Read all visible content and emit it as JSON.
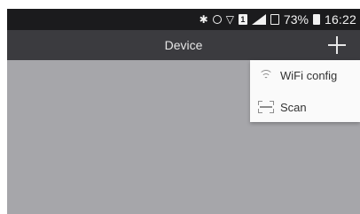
{
  "status_bar": {
    "battery_percent": "73%",
    "time": "16:22",
    "sim_label": "1",
    "icons": [
      "bluetooth-icon",
      "alarm-icon",
      "wifi-icon",
      "sim-icon",
      "signal-icon",
      "download-icon",
      "battery-icon"
    ]
  },
  "app_bar": {
    "title": "Device",
    "add_icon": "plus-icon"
  },
  "menu": {
    "items": [
      {
        "label": "WiFi config",
        "icon": "wifi-icon"
      },
      {
        "label": "Scan",
        "icon": "scan-icon"
      }
    ]
  },
  "colors": {
    "status_bar_bg": "#1b1b1d",
    "app_bar_bg": "#3b3b3f",
    "content_bg": "#a6a6aa",
    "menu_bg": "#fafafa"
  }
}
